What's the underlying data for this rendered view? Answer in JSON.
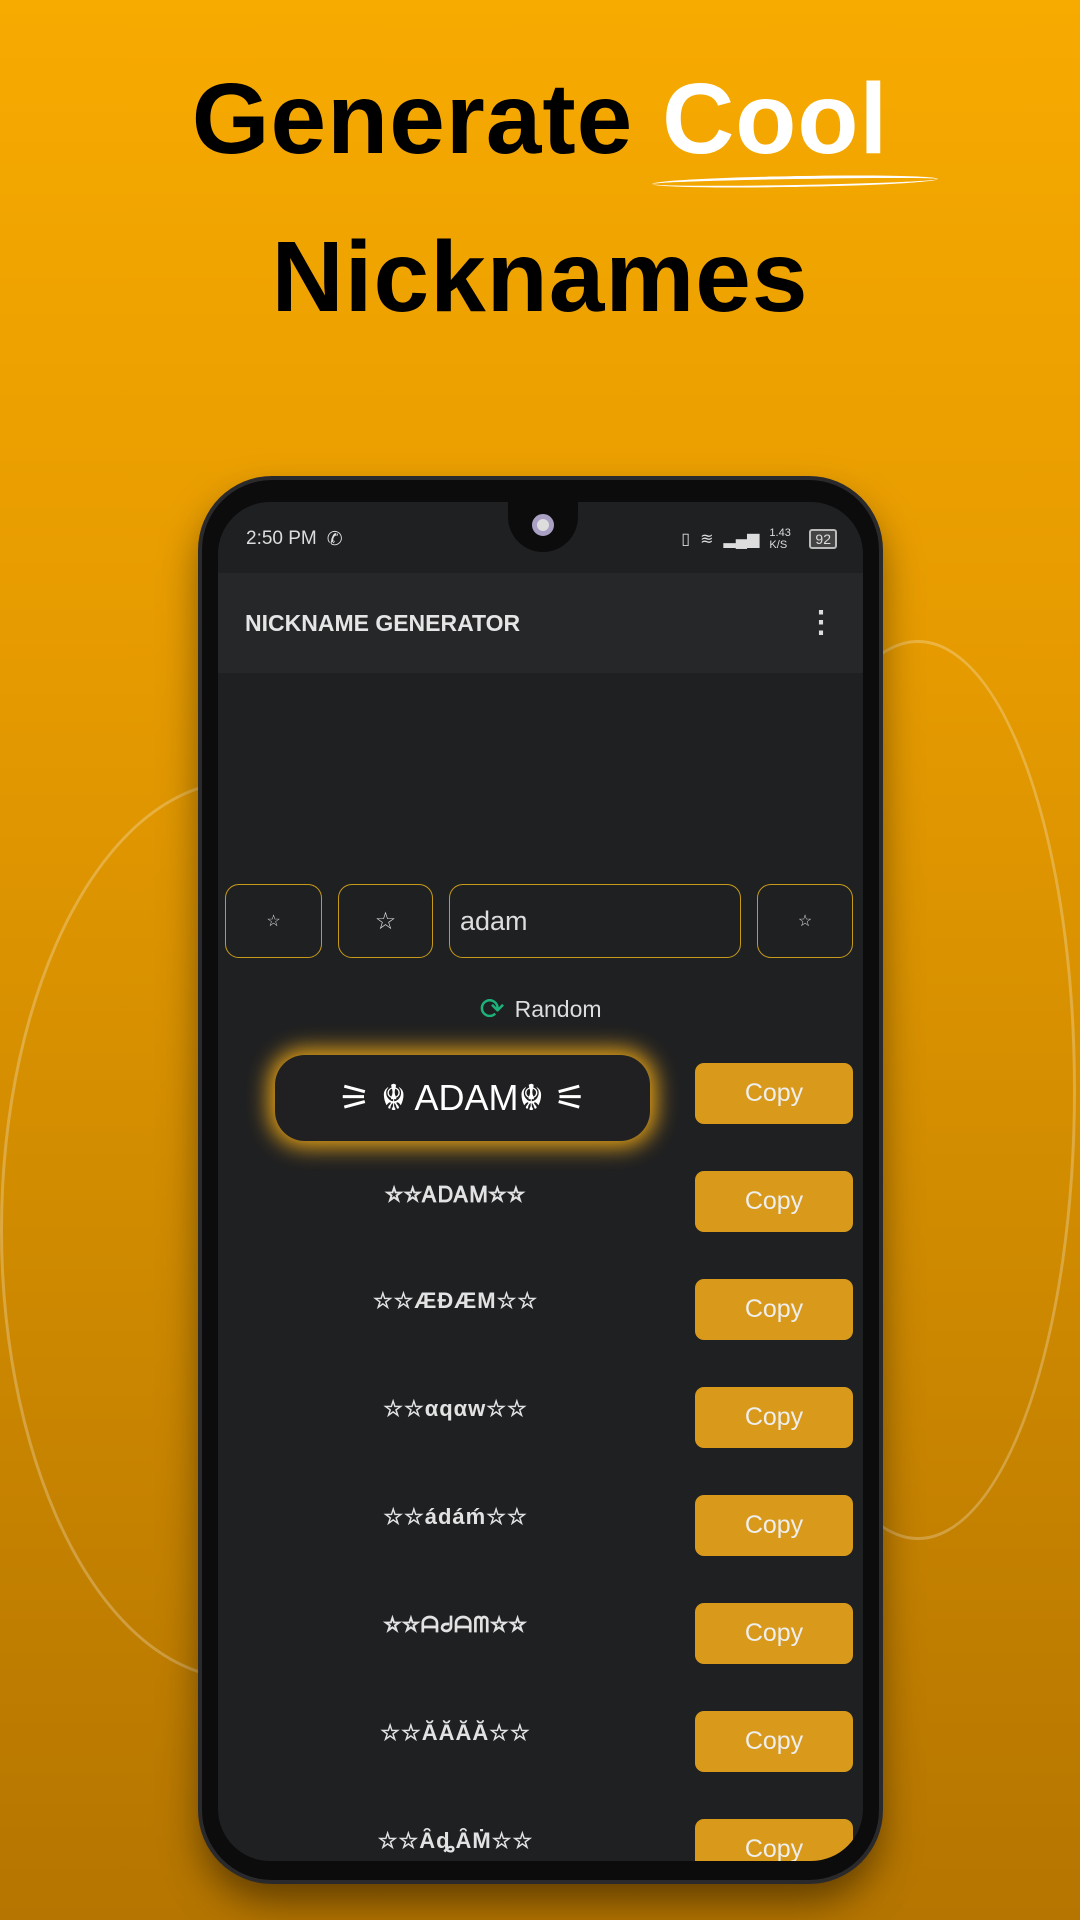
{
  "promo": {
    "line1": "Generate ",
    "line1_highlight": "Cool",
    "line2": "Nicknames"
  },
  "status": {
    "time": "2:50 PM",
    "speed": "1.43 K/S",
    "battery": "92"
  },
  "appbar": {
    "title": "NICKNAME GENERATOR",
    "menu_icon": "more-vert-icon"
  },
  "inputs": {
    "prefix1": "☆",
    "prefix2": "☆",
    "name": "adam",
    "suffix": "☆"
  },
  "random": {
    "label": "Random",
    "icon": "refresh-icon"
  },
  "nicknames": [
    {
      "text": "⚞ ☬ ADAM☬ ⚟",
      "copy": "Copy"
    },
    {
      "text": "☆☆ᎪᎠᎪᎷ☆☆",
      "copy": "Copy"
    },
    {
      "text": "☆☆ÆĐÆM☆☆",
      "copy": "Copy"
    },
    {
      "text": "☆☆αqαw☆☆",
      "copy": "Copy"
    },
    {
      "text": "☆☆ádáḿ☆☆",
      "copy": "Copy"
    },
    {
      "text": "☆☆ᗩᑯᗩᗰ☆☆",
      "copy": "Copy"
    },
    {
      "text": "☆☆ᾸᾸᾸᾸ☆☆",
      "copy": "Copy"
    },
    {
      "text": "☆☆ȂȡȂṀ☆☆",
      "copy": "Copy"
    }
  ],
  "colors": {
    "accent": "#d99a1b",
    "background": "#f7aa00",
    "screen": "#1f2022",
    "random_icon": "#1db27a"
  }
}
